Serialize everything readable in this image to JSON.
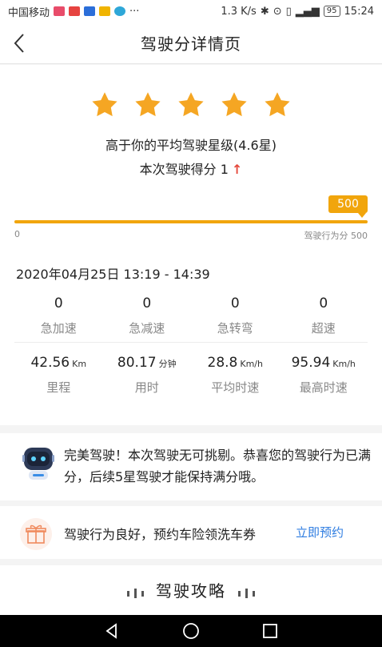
{
  "status_bar": {
    "carrier": "中国移动",
    "more": "···",
    "speed": "1.3 K/s",
    "battery": "95",
    "time": "15:24"
  },
  "header": {
    "title": "驾驶分详情页"
  },
  "rating": {
    "stars_filled": 5,
    "stars_total": 5,
    "level_text": "高于你的平均驾驶星级(4.6星)",
    "score_label": "本次驾驶得分",
    "score_value": "1",
    "score_arrow": "↑"
  },
  "progress": {
    "bubble": "500",
    "min": "0",
    "max_label": "驾驶行为分 500",
    "fraction": 1.0
  },
  "trip": {
    "date": "2020年04月25日 13:19 - 14:39",
    "events": [
      {
        "value": "0",
        "label": "急加速"
      },
      {
        "value": "0",
        "label": "急减速"
      },
      {
        "value": "0",
        "label": "急转弯"
      },
      {
        "value": "0",
        "label": "超速"
      }
    ],
    "metrics": [
      {
        "value": "42.56",
        "unit": "Km",
        "label": "里程"
      },
      {
        "value": "80.17",
        "unit": "分钟",
        "label": "用时"
      },
      {
        "value": "28.8",
        "unit": "Km/h",
        "label": "平均时速"
      },
      {
        "value": "95.94",
        "unit": "Km/h",
        "label": "最高时速"
      }
    ]
  },
  "message": {
    "text": "完美驾驶！本次驾驶无可挑剔。恭喜您的驾驶行为已满分，后续5星驾驶才能保持满分哦。"
  },
  "promo": {
    "text": "驾驶行为良好，预约车险领洗车券",
    "action": "立即预约"
  },
  "tips": {
    "title": "驾驶攻略"
  },
  "colors": {
    "accent": "#f1a50c",
    "star": "#f5a623",
    "link": "#2f7de1",
    "up": "#e5483b"
  }
}
